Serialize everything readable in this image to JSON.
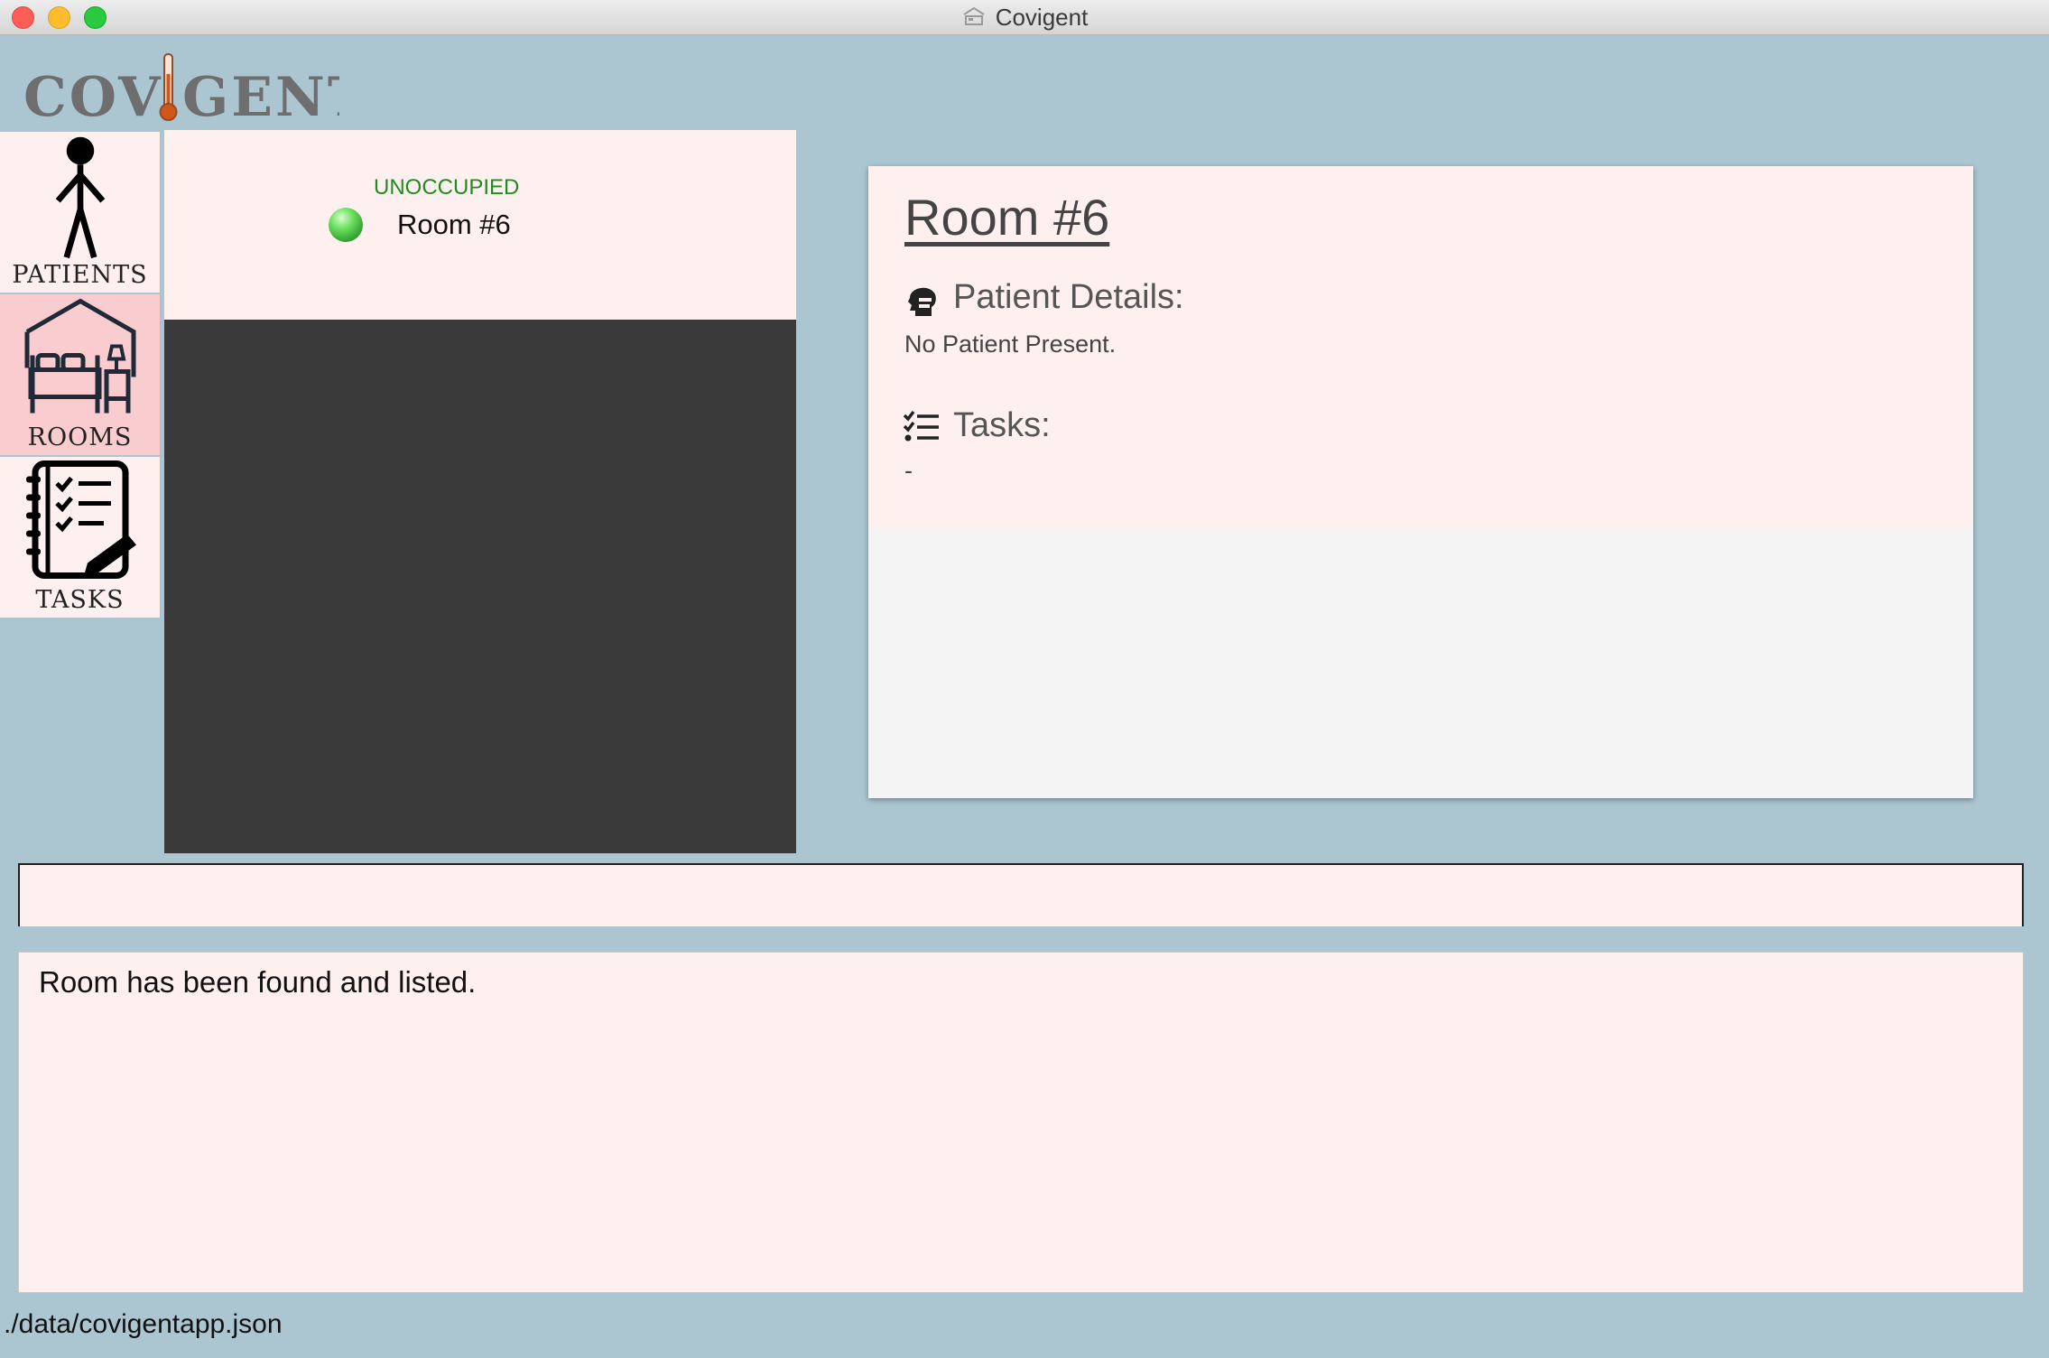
{
  "window": {
    "title": "Covigent"
  },
  "logo": {
    "text": "COVIGENT"
  },
  "nav": {
    "items": [
      {
        "label": "PATIENTS",
        "icon": "person-icon",
        "active": false
      },
      {
        "label": "ROOMS",
        "icon": "bed-house-icon",
        "active": true
      },
      {
        "label": "TASKS",
        "icon": "checklist-notebook-icon",
        "active": false
      }
    ]
  },
  "room_list": {
    "items": [
      {
        "status": "UNOCCUPIED",
        "name": "Room #6",
        "status_color": "#1e8c1e"
      }
    ]
  },
  "details": {
    "title": "Room #6",
    "patient_heading": "Patient Details:",
    "patient_text": "No Patient Present.",
    "tasks_heading": "Tasks:",
    "tasks_text": "-"
  },
  "command": {
    "value": ""
  },
  "result": {
    "text": "Room has been found and listed."
  },
  "status_bar": {
    "path": "./data/covigentapp.json"
  },
  "colors": {
    "background": "#abc6d1",
    "panel": "#fff0f0",
    "active_nav": "#f9cdcf",
    "list_bg": "#3a3a3a",
    "status_green": "#1e8c1e"
  }
}
